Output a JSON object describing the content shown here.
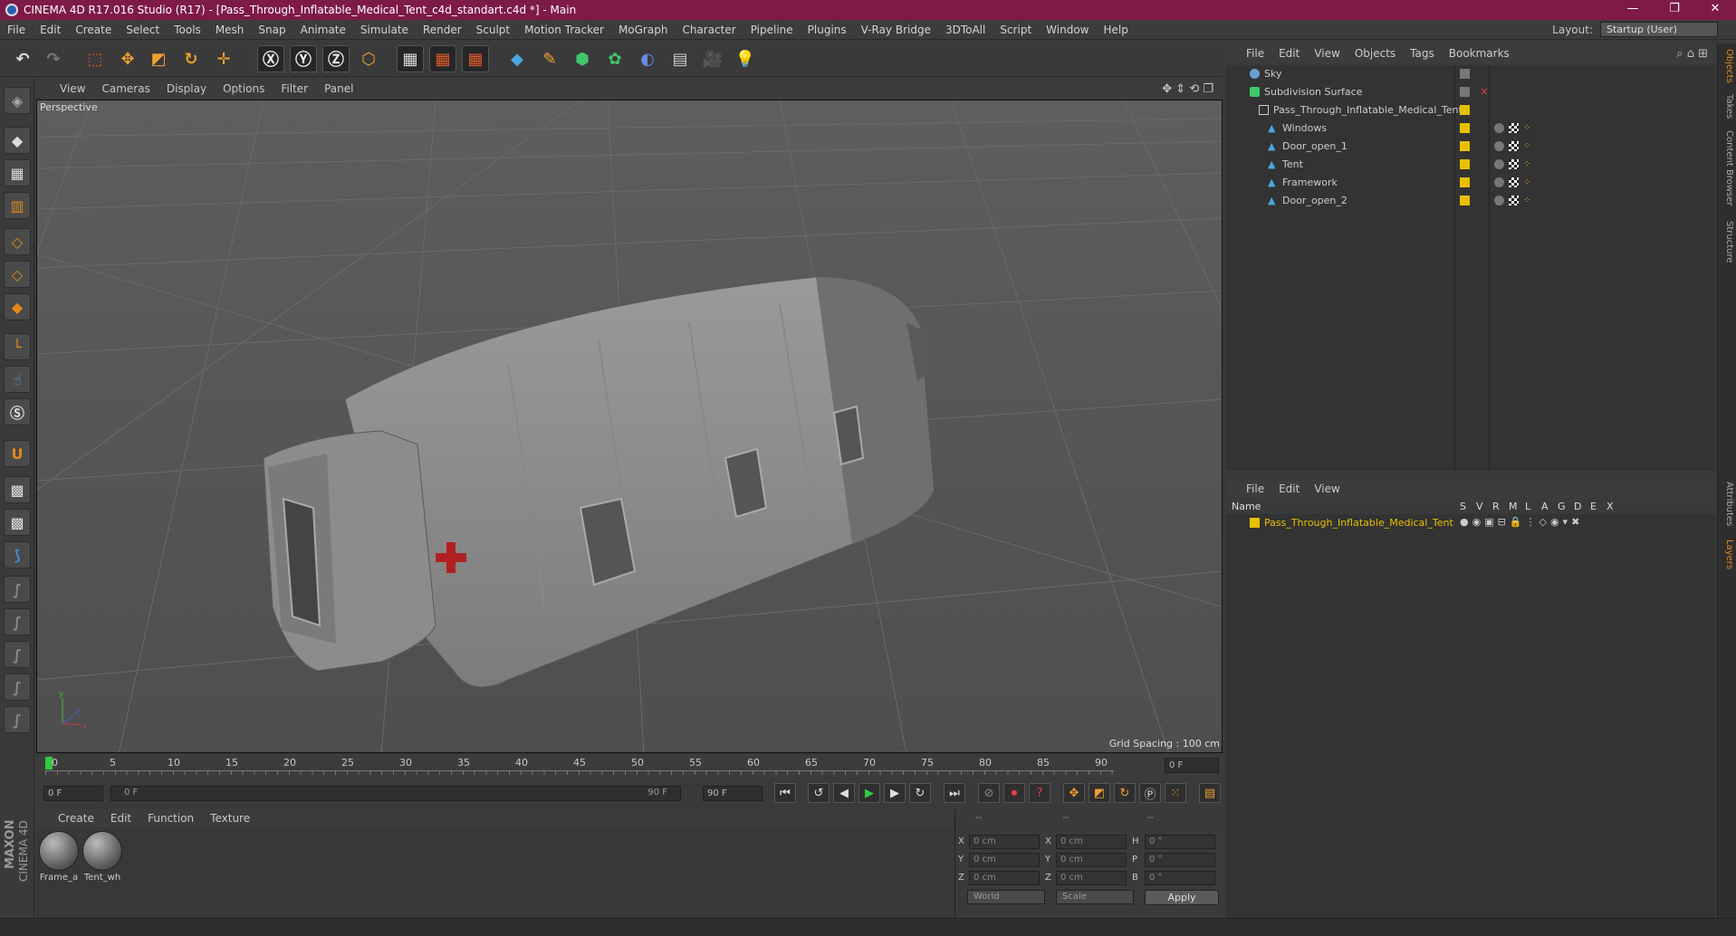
{
  "window": {
    "title": "CINEMA 4D R17.016 Studio (R17) - [Pass_Through_Inflatable_Medical_Tent_c4d_standart.c4d *] - Main",
    "controls": [
      "—",
      "❐",
      "✕"
    ]
  },
  "menu": [
    "File",
    "Edit",
    "Create",
    "Select",
    "Tools",
    "Mesh",
    "Snap",
    "Animate",
    "Simulate",
    "Render",
    "Sculpt",
    "Motion Tracker",
    "MoGraph",
    "Character",
    "Pipeline",
    "Plugins",
    "V-Ray Bridge",
    "3DToAll",
    "Script",
    "Window",
    "Help"
  ],
  "layout": {
    "label": "Layout:",
    "value": "Startup (User)"
  },
  "viewport": {
    "menu": [
      "View",
      "Cameras",
      "Display",
      "Options",
      "Filter",
      "Panel"
    ],
    "label": "Perspective",
    "grid_spacing": "Grid Spacing : 100 cm"
  },
  "timeline": {
    "ticks": [
      "0",
      "5",
      "10",
      "15",
      "20",
      "25",
      "30",
      "35",
      "40",
      "45",
      "50",
      "55",
      "60",
      "65",
      "70",
      "75",
      "80",
      "85",
      "90"
    ],
    "current_frame": "0 F",
    "start_field": "0 F",
    "range_start": "0 F",
    "range_end": "90 F",
    "end_field": "90 F"
  },
  "materials": {
    "menu": [
      "Create",
      "Edit",
      "Function",
      "Texture"
    ],
    "items": [
      {
        "label": "Frame_a"
      },
      {
        "label": "Tent_wh"
      }
    ]
  },
  "coordinates": {
    "headers": [
      "--",
      "--",
      "--"
    ],
    "rows": [
      {
        "a": "X",
        "av": "0 cm",
        "b": "X",
        "bv": "0 cm",
        "c": "H",
        "cv": "0 °"
      },
      {
        "a": "Y",
        "av": "0 cm",
        "b": "Y",
        "bv": "0 cm",
        "c": "P",
        "cv": "0 °"
      },
      {
        "a": "Z",
        "av": "0 cm",
        "b": "Z",
        "bv": "0 cm",
        "c": "B",
        "cv": "0 °"
      }
    ],
    "space": "World",
    "mode": "Scale",
    "apply": "Apply"
  },
  "object_manager": {
    "menu": [
      "File",
      "Edit",
      "View",
      "Objects",
      "Tags",
      "Bookmarks"
    ],
    "objects": [
      {
        "name": "Sky",
        "indent": 0
      },
      {
        "name": "Subdivision Surface",
        "indent": 0
      },
      {
        "name": "Pass_Through_Inflatable_Medical_Tent",
        "indent": 1
      },
      {
        "name": "Windows",
        "indent": 2
      },
      {
        "name": "Door_open_1",
        "indent": 2
      },
      {
        "name": "Tent",
        "indent": 2
      },
      {
        "name": "Framework",
        "indent": 2
      },
      {
        "name": "Door_open_2",
        "indent": 2
      }
    ]
  },
  "layer_manager": {
    "menu": [
      "File",
      "Edit",
      "View"
    ],
    "columns": [
      "Name",
      "S",
      "V",
      "R",
      "M",
      "L",
      "A",
      "G",
      "D",
      "E",
      "X"
    ],
    "layers": [
      {
        "name": "Pass_Through_Inflatable_Medical_Tent",
        "color": "#e8c000"
      }
    ]
  },
  "right_tabs": [
    "Objects",
    "Takes",
    "Content Browser",
    "Structure",
    "Attributes",
    "Layers"
  ],
  "brand": {
    "maxon": "MAXON",
    "product": "CINEMA 4D"
  },
  "colors": {
    "titlebar": "#7e1a48",
    "accent_orange": "#e08a1e",
    "layer_yellow": "#e8c000",
    "play_green": "#2ecc40"
  }
}
